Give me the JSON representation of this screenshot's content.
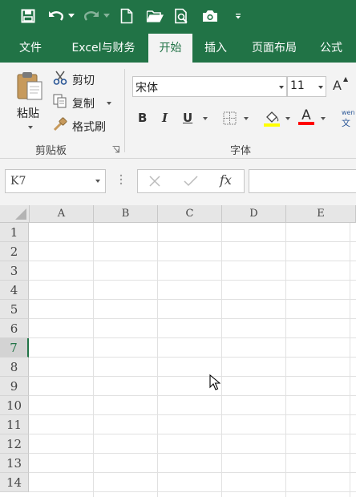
{
  "theme": {
    "accent": "#217346",
    "ribbon_bg": "#f3f3f3",
    "fill_color": "#ffff00",
    "font_color": "#ff0000"
  },
  "quick_access": {
    "icons": [
      "save-icon",
      "undo-icon",
      "redo-icon",
      "new-document-icon",
      "open-folder-icon",
      "print-preview-icon",
      "camera-icon",
      "customize-icon"
    ]
  },
  "tabs": [
    "文件",
    "Excel与财务",
    "开始",
    "插入",
    "页面布局",
    "公式"
  ],
  "active_tab": "开始",
  "clipboard": {
    "paste": "粘贴",
    "cut": "剪切",
    "copy": "复制",
    "format_painter": "格式刷",
    "group_label": "剪贴板"
  },
  "font": {
    "name": "宋体",
    "size": "11",
    "bold": "B",
    "italic": "I",
    "underline": "U",
    "font_color_letter": "A",
    "grow_font": "A",
    "group_label": "字体",
    "phonetic": "文"
  },
  "formula_bar": {
    "name_box": "K7",
    "fx": "fx",
    "value": ""
  },
  "sheet": {
    "columns": [
      "A",
      "B",
      "C",
      "D",
      "E"
    ],
    "rows": [
      "1",
      "2",
      "3",
      "4",
      "5",
      "6",
      "7",
      "8",
      "9",
      "10",
      "11",
      "12",
      "13",
      "14"
    ],
    "active_row": "7"
  }
}
